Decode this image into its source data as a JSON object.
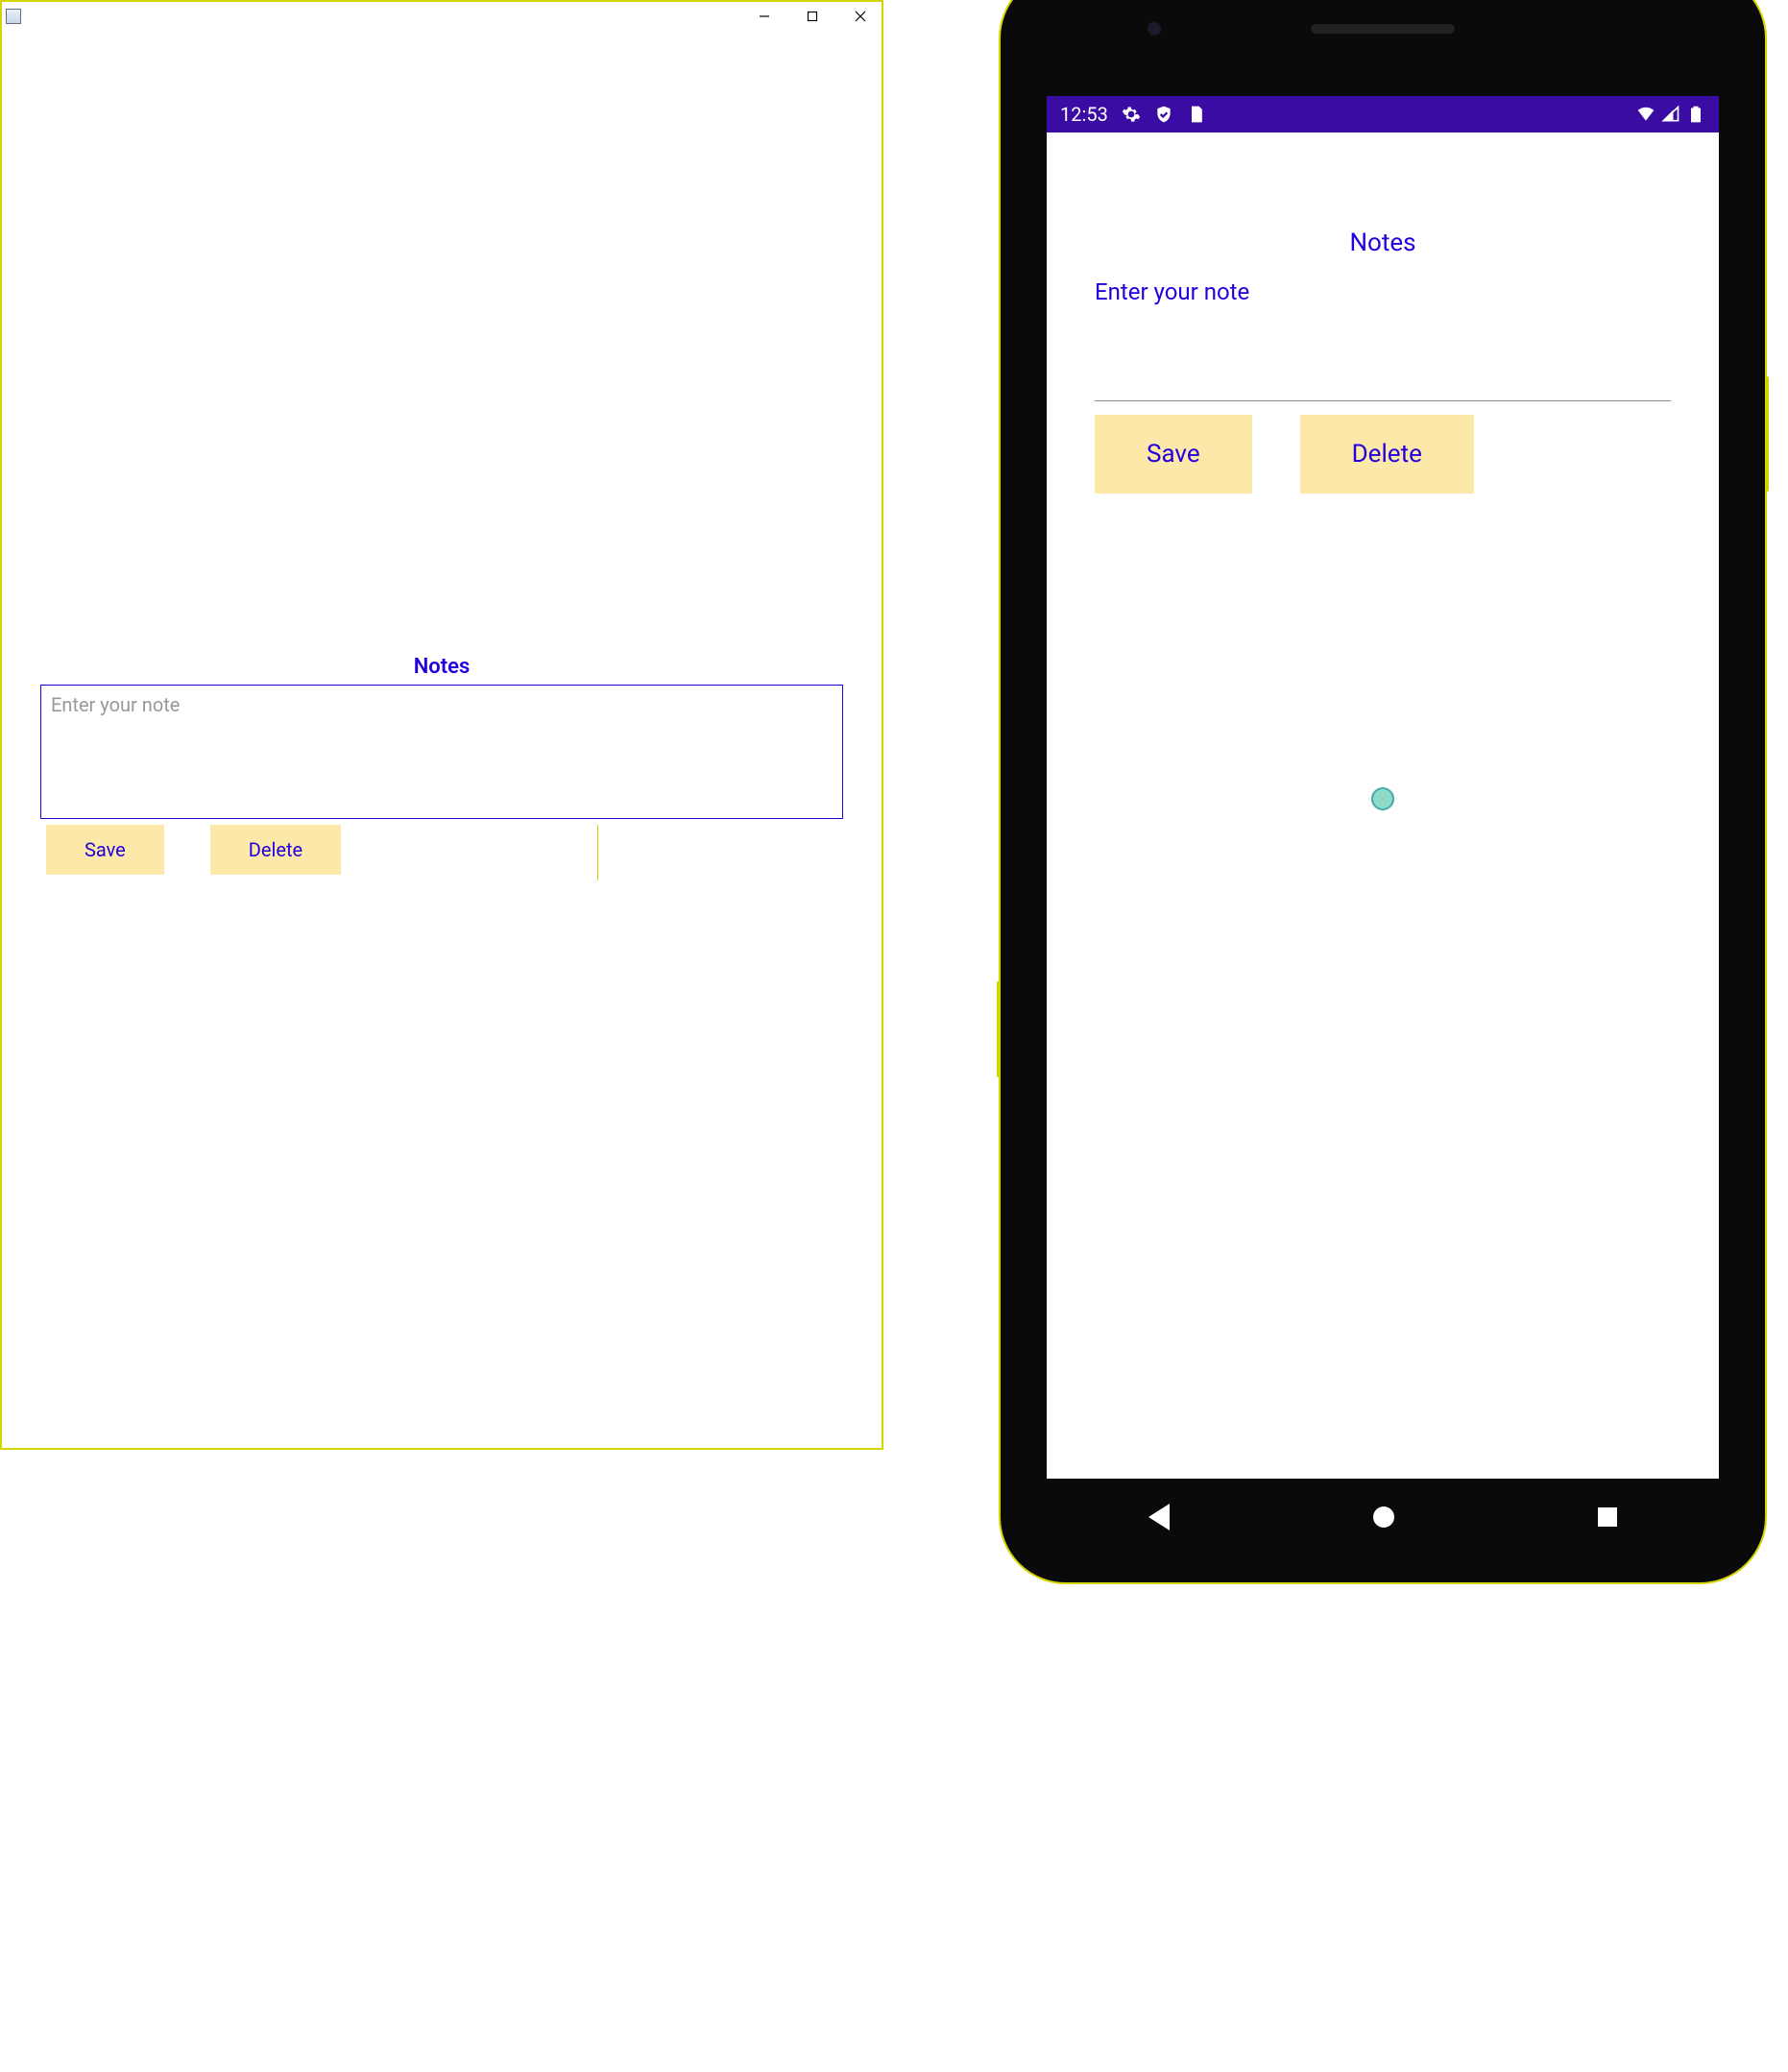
{
  "colors": {
    "accent_yellow": "#d4d400",
    "button_bg": "#fce8a8",
    "primary_text": "#2200dd",
    "statusbar_bg": "#3a0ca3"
  },
  "desktop": {
    "title": "Notes",
    "note_input": {
      "placeholder": "Enter your note",
      "value": ""
    },
    "buttons": {
      "save": "Save",
      "delete": "Delete"
    },
    "window_controls": {
      "minimize": "minimize",
      "maximize": "maximize",
      "close": "close"
    }
  },
  "phone": {
    "statusbar": {
      "time": "12:53",
      "icons_left": [
        "gear-icon",
        "shield-icon",
        "sim-icon"
      ],
      "icons_right": [
        "wifi-icon",
        "signal-icon",
        "battery-icon"
      ]
    },
    "title": "Notes",
    "note_input": {
      "placeholder": "Enter your note",
      "value": ""
    },
    "buttons": {
      "save": "Save",
      "delete": "Delete"
    },
    "nav": {
      "back": "back",
      "home": "home",
      "recent": "recent"
    }
  }
}
